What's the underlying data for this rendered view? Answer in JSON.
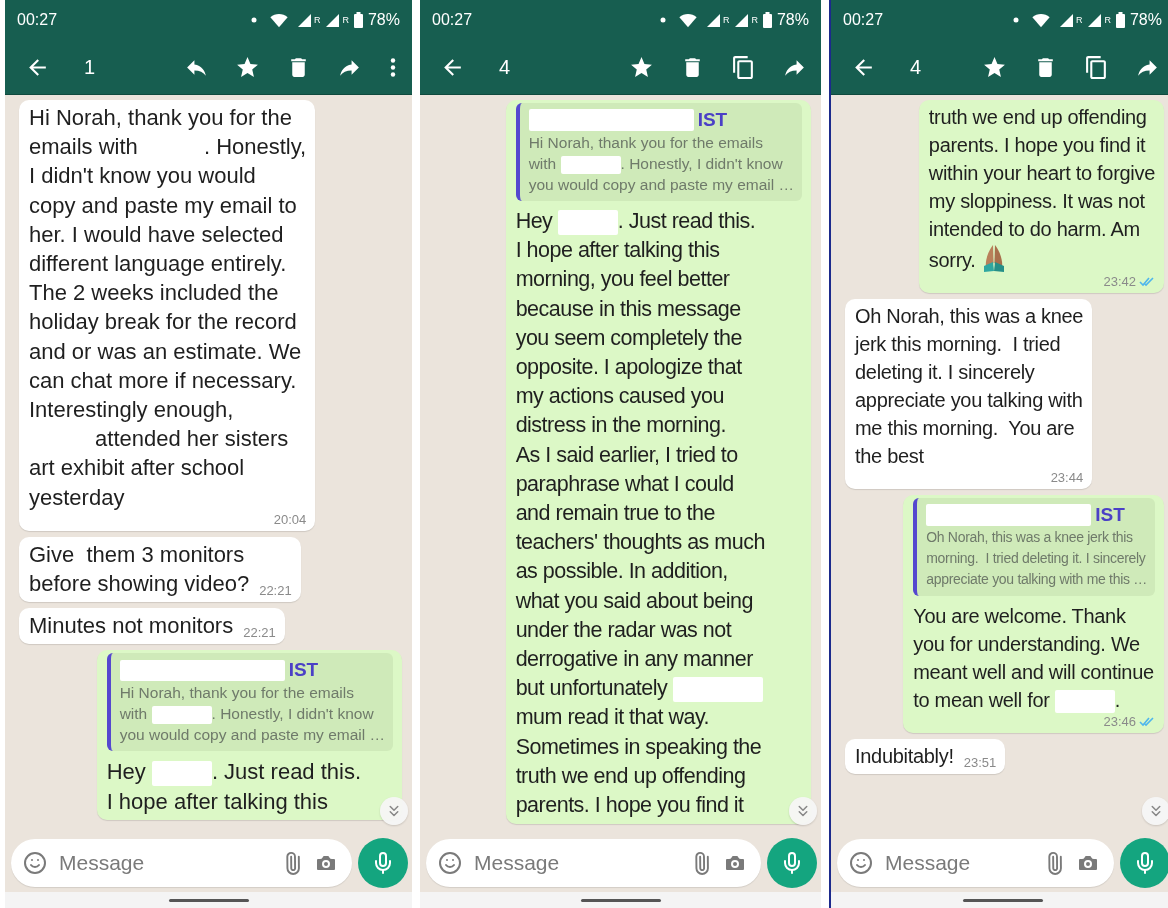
{
  "panels": [
    {
      "status_bar": {
        "time": "00:27",
        "network_labels": [
          "R",
          "R"
        ],
        "battery": "78%"
      },
      "toolbar": {
        "selected_count": "1",
        "actions": [
          {
            "kind": "reply"
          },
          {
            "kind": "star"
          },
          {
            "kind": "delete"
          },
          {
            "kind": "forward"
          },
          {
            "kind": "more"
          }
        ]
      },
      "messages": [
        {
          "outgoing": false,
          "lines": [
            [
              "Hi Norah, thank you for the"
            ],
            [
              "emails with ",
              {
                "kind": "redaction"
              },
              ". Honestly,"
            ],
            [
              "I didn't know you would"
            ],
            [
              "copy and paste my email to"
            ],
            [
              "her. I would have selected"
            ],
            [
              "different language entirely."
            ],
            [
              "The 2 weeks included the"
            ],
            [
              "holiday break for the record"
            ],
            [
              "and or was an estimate. We"
            ],
            [
              "can chat more if necessary."
            ],
            [
              "Interestingly enough,"
            ],
            [
              {
                "kind": "redaction"
              },
              " attended her sisters"
            ],
            [
              "art exhibit after school"
            ],
            [
              "yesterday"
            ]
          ],
          "time": "20:04"
        },
        {
          "outgoing": false,
          "lines": [
            [
              "Give  them 3 monitors"
            ],
            [
              "before showing video?"
            ]
          ],
          "time": "22:21"
        },
        {
          "outgoing": false,
          "lines": [
            [
              "Minutes not monitors"
            ]
          ],
          "time": "22:21"
        },
        {
          "outgoing": true,
          "quote": {
            "author": [
              {
                "kind": "redaction",
                "wide": true
              },
              "IST"
            ],
            "lines": [
              "Hi Norah, thank you for the emails",
              [
                "with ",
                {
                  "kind": "redaction"
                },
                ". Honestly, I didn't know"
              ],
              "you would copy and paste my email …"
            ]
          },
          "lines": [
            [
              "Hey ",
              {
                "kind": "redaction"
              },
              ". Just read this."
            ],
            [
              "I hope after talking this"
            ]
          ]
        }
      ],
      "composer": {
        "placeholder": "Message"
      }
    },
    {
      "status_bar": {
        "time": "00:27",
        "network_labels": [
          "R",
          "R"
        ],
        "battery": "78%"
      },
      "toolbar": {
        "selected_count": "4",
        "actions": [
          {
            "kind": "star"
          },
          {
            "kind": "delete"
          },
          {
            "kind": "copy"
          },
          {
            "kind": "forward"
          }
        ]
      },
      "messages": [
        {
          "outgoing": true,
          "quote": {
            "author": [
              {
                "kind": "redaction",
                "wide": true
              },
              "IST"
            ],
            "lines": [
              "Hi Norah, thank you for the emails",
              [
                "with ",
                {
                  "kind": "redaction"
                },
                ". Honestly, I didn't know"
              ],
              "you would copy and paste my email …"
            ]
          },
          "lines": [
            [
              "Hey ",
              {
                "kind": "redaction"
              },
              ". Just read this."
            ],
            [
              "I hope after talking this"
            ],
            [
              "morning, you feel better"
            ],
            [
              "because in this message"
            ],
            [
              "you seem completely the"
            ],
            [
              "opposite. I apologize that"
            ],
            [
              "my actions caused you"
            ],
            [
              "distress in the morning."
            ],
            [
              "As I said earlier, I tried to"
            ],
            [
              "paraphrase what I could"
            ],
            [
              "and remain true to the"
            ],
            [
              "teachers' thoughts as much"
            ],
            [
              "as possible. In addition,"
            ],
            [
              "what you said about being"
            ],
            [
              "under the radar was not"
            ],
            [
              "derrogative in any manner"
            ],
            [
              "but unfortunately ",
              {
                "kind": "redaction",
                "long": true
              }
            ],
            [
              "mum read it that way."
            ],
            [
              "Sometimes in speaking the"
            ],
            [
              "truth we end up offending"
            ],
            [
              "parents. I hope you find it"
            ]
          ]
        }
      ],
      "composer": {
        "placeholder": "Message"
      }
    },
    {
      "status_bar": {
        "time": "00:27",
        "network_labels": [
          "R",
          "R"
        ],
        "battery": "78%"
      },
      "toolbar": {
        "selected_count": "4",
        "actions": [
          {
            "kind": "star"
          },
          {
            "kind": "delete"
          },
          {
            "kind": "copy"
          },
          {
            "kind": "forward"
          }
        ]
      },
      "messages": [
        {
          "outgoing": true,
          "lines": [
            [
              "truth we end up offending"
            ],
            [
              "parents. I hope you find it"
            ],
            [
              "within your heart to forgive"
            ],
            [
              "my sloppiness. It was not"
            ],
            [
              "intended to do harm. Am"
            ],
            [
              "sorry. ",
              {
                "kind": "emoji"
              }
            ]
          ],
          "time": "23:42",
          "read": true
        },
        {
          "outgoing": false,
          "lines": [
            [
              "Oh Norah, this was a knee"
            ],
            [
              "jerk this morning.  I tried"
            ],
            [
              "deleting it. I sincerely"
            ],
            [
              "appreciate you talking with"
            ],
            [
              "me this morning.  You are"
            ],
            [
              "the best"
            ]
          ],
          "time": "23:44"
        },
        {
          "outgoing": true,
          "quote": {
            "author": [
              {
                "kind": "redaction",
                "wide": true
              },
              "IST"
            ],
            "lines": [
              "Oh Norah, this was a knee jerk this",
              "morning.  I tried deleting it. I sincerely",
              "appreciate you talking with me this …"
            ]
          },
          "lines": [
            [
              "You are welcome. Thank"
            ],
            [
              "you for understanding. We"
            ],
            [
              "meant well and will continue"
            ],
            [
              "to mean well for ",
              {
                "kind": "redaction"
              },
              "."
            ]
          ],
          "time": "23:46",
          "read": true
        },
        {
          "outgoing": false,
          "lines": [
            [
              "Indubitably!"
            ]
          ],
          "time": "23:51"
        }
      ],
      "composer": {
        "placeholder": "Message"
      }
    }
  ]
}
